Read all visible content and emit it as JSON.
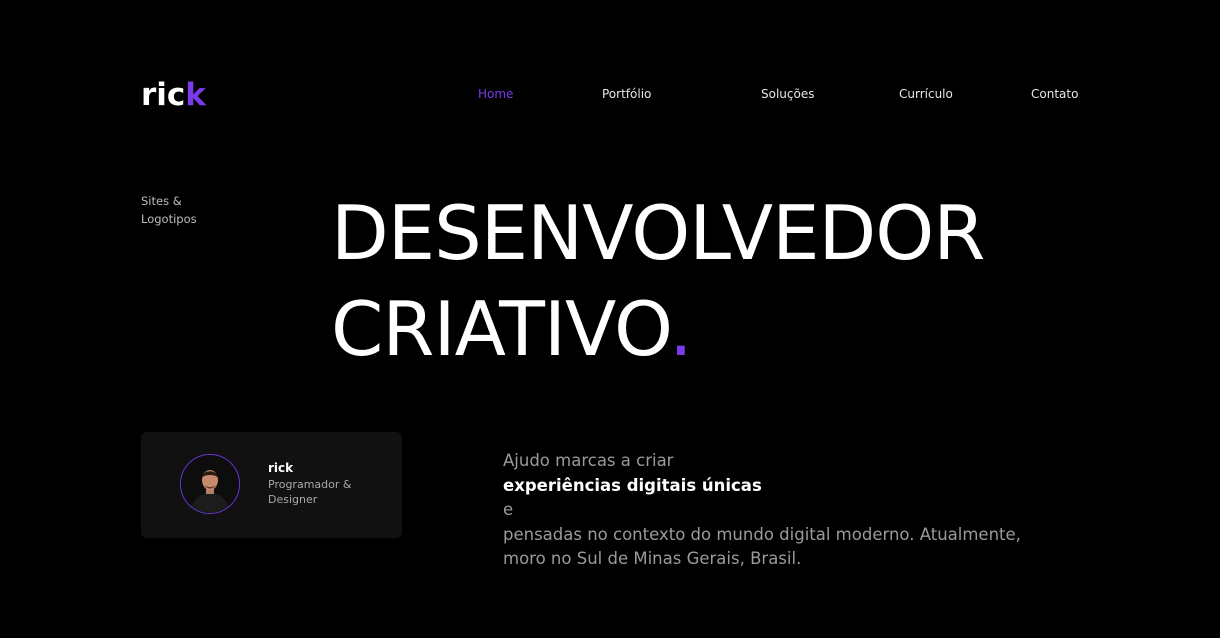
{
  "header": {
    "logo": {
      "text_main": "ric",
      "text_accent": "k"
    },
    "nav": [
      {
        "label": "Home",
        "active": true
      },
      {
        "label": "Portfólio",
        "active": false
      },
      {
        "label": "Soluções",
        "active": false
      },
      {
        "label": "Currículo",
        "active": false
      },
      {
        "label": "Contato",
        "active": false
      }
    ]
  },
  "tagline": {
    "line1": "Sites &",
    "line2": "Logotipos"
  },
  "hero": {
    "line1": "DESENVOLVEDOR",
    "line2": "CRIATIVO",
    "dot": "."
  },
  "profile": {
    "name": "rick",
    "role_line1": "Programador &",
    "role_line2": "Designer",
    "avatar_icon": "person-photo-icon"
  },
  "intro": {
    "line1_before": "Ajudo marcas a criar ",
    "line1_highlight": "experiências digitais únicas",
    "line1_after": " e",
    "line2": "pensadas no contexto do mundo digital moderno. Atualmente,",
    "line3": "moro no Sul de Minas Gerais, Brasil."
  },
  "colors": {
    "background": "#000000",
    "accent": "#7c3aed",
    "card": "#111111",
    "text": "#ffffff",
    "muted": "#9a9a9a"
  }
}
